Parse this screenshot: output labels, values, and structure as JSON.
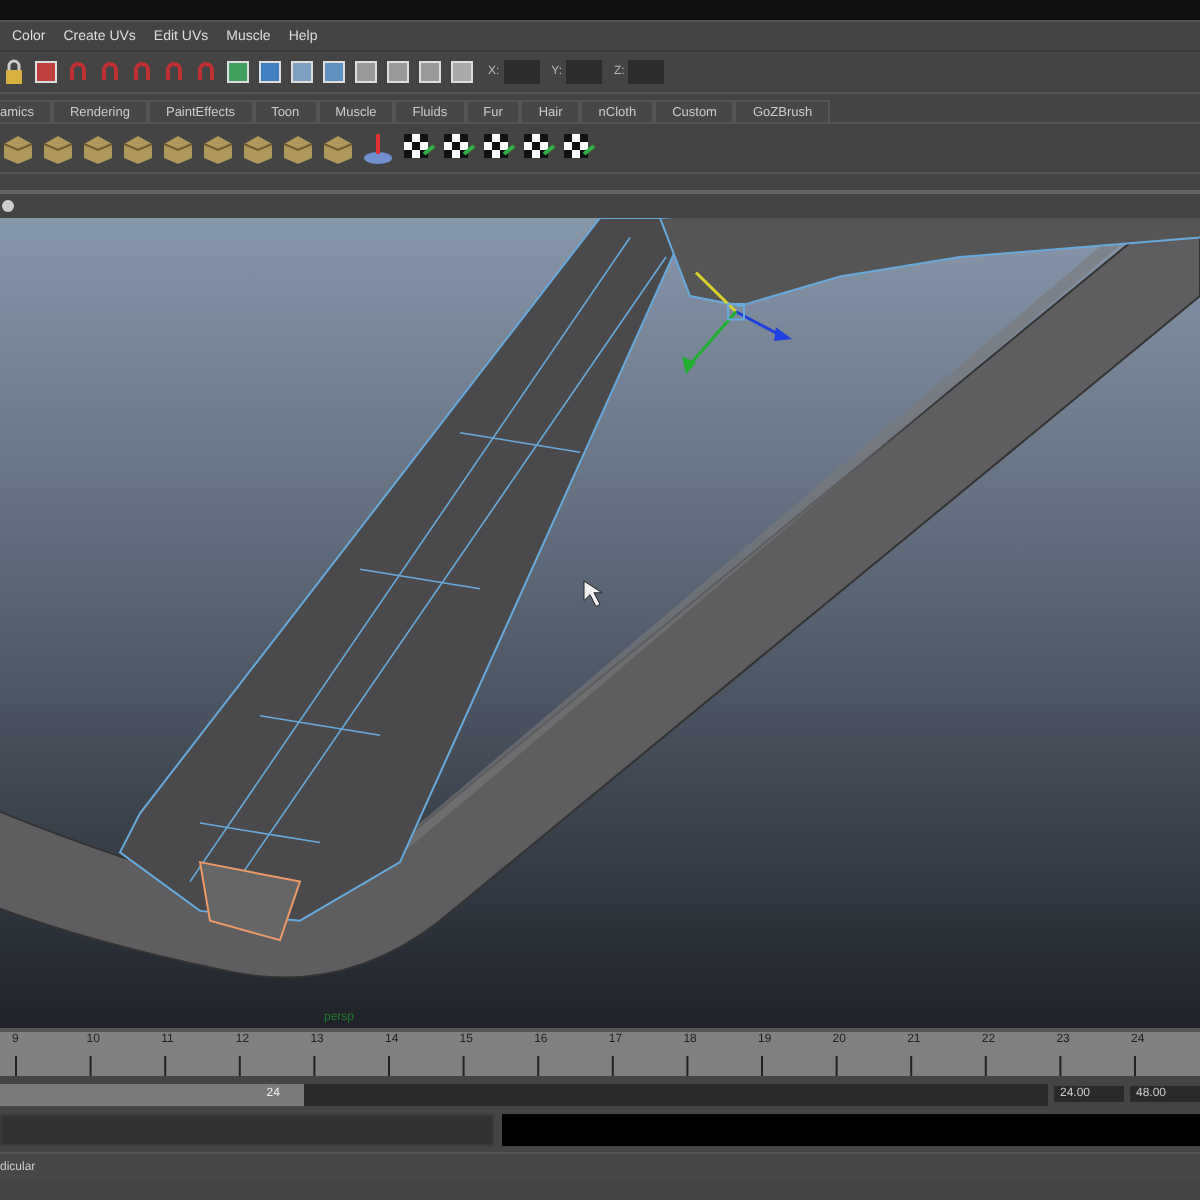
{
  "menu_bar": [
    "Color",
    "Create UVs",
    "Edit UVs",
    "Muscle",
    "Help"
  ],
  "status_line": {
    "fields": [
      {
        "label": "X:"
      },
      {
        "label": "Y:"
      },
      {
        "label": "Z:"
      }
    ]
  },
  "shelf_tabs": [
    "amics",
    "Rendering",
    "PaintEffects",
    "Toon",
    "Muscle",
    "Fluids",
    "Fur",
    "Hair",
    "nCloth",
    "Custom",
    "GoZBrush"
  ],
  "viewport": {
    "camera_label": "persp"
  },
  "time_slider": {
    "ticks": [
      "9",
      "10",
      "11",
      "12",
      "13",
      "14",
      "15",
      "16",
      "17",
      "18",
      "19",
      "20",
      "21",
      "22",
      "23",
      "24"
    ]
  },
  "range_slider": {
    "handle_value": "24",
    "level": 0.29,
    "end_time": "24.00",
    "max_time": "48.00"
  },
  "help_line": "dicular"
}
